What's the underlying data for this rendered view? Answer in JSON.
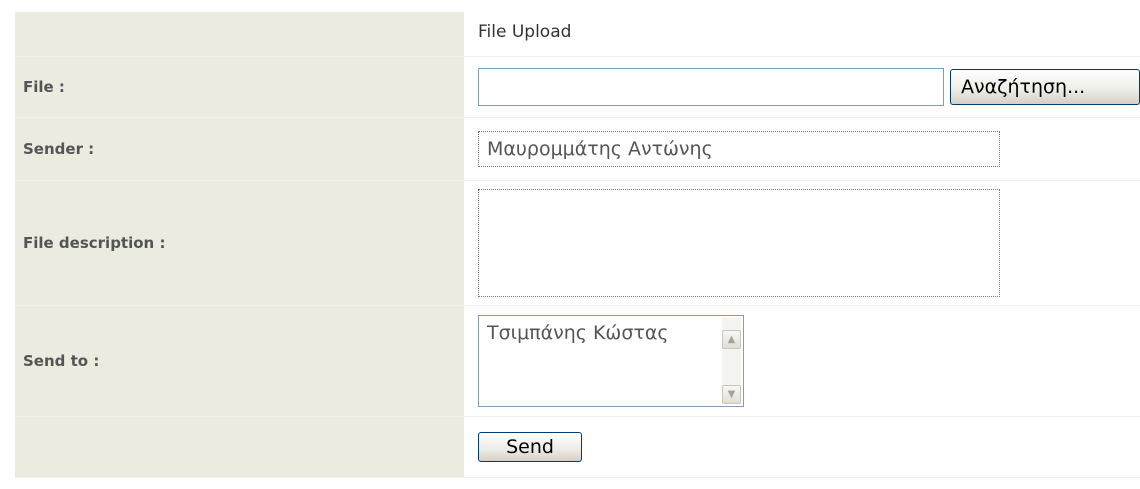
{
  "form": {
    "header": "File Upload",
    "file": {
      "label": "File :",
      "value": "",
      "browse_label": "Αναζήτηση..."
    },
    "sender": {
      "label": "Sender :",
      "value": "Μαυρομμάτης Αντώνης"
    },
    "description": {
      "label": "File description :",
      "value": ""
    },
    "send_to": {
      "label": "Send to :",
      "options": [
        "Τσιμπάνης Κώστας"
      ]
    },
    "send_label": "Send"
  },
  "icons": {
    "scroll_up": "chevron-up-icon",
    "scroll_down": "chevron-down-icon"
  },
  "colors": {
    "label_background": "#ecebe0",
    "label_text": "#555555",
    "button_border": "#003c74",
    "input_border": "#7f9db9"
  }
}
